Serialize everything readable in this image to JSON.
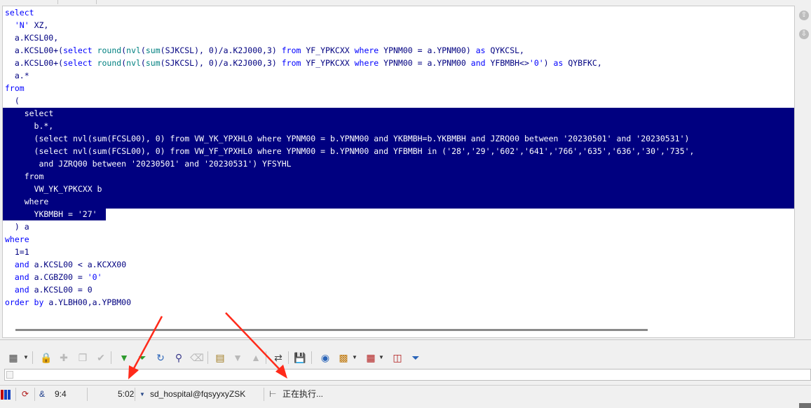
{
  "editor": {
    "lines": [
      {
        "spans": [
          [
            "k",
            "select"
          ]
        ]
      },
      {
        "spans": [
          [
            "t",
            "  "
          ],
          [
            "s",
            "'N'"
          ],
          [
            "t",
            " XZ,"
          ]
        ]
      },
      {
        "spans": [
          [
            "t",
            "  a.KCSL00,"
          ]
        ]
      },
      {
        "spans": [
          [
            "t",
            "  a.KCSL00+("
          ],
          [
            "k",
            "select"
          ],
          [
            "t",
            " "
          ],
          [
            "f",
            "round"
          ],
          [
            "t",
            "("
          ],
          [
            "f",
            "nvl"
          ],
          [
            "t",
            "("
          ],
          [
            "f",
            "sum"
          ],
          [
            "t",
            "(SJKCSL), 0)/a.K2J000,3) "
          ],
          [
            "k",
            "from"
          ],
          [
            "t",
            " YF_YPKCXX "
          ],
          [
            "k",
            "where"
          ],
          [
            "t",
            " YPNM00 = a.YPNM00) "
          ],
          [
            "k",
            "as"
          ],
          [
            "t",
            " QYKCSL,"
          ]
        ]
      },
      {
        "spans": [
          [
            "t",
            "  a.KCSL00+("
          ],
          [
            "k",
            "select"
          ],
          [
            "t",
            " "
          ],
          [
            "f",
            "round"
          ],
          [
            "t",
            "("
          ],
          [
            "f",
            "nvl"
          ],
          [
            "t",
            "("
          ],
          [
            "f",
            "sum"
          ],
          [
            "t",
            "(SJKCSL), 0)/a.K2J000,3) "
          ],
          [
            "k",
            "from"
          ],
          [
            "t",
            " YF_YPKCXX "
          ],
          [
            "k",
            "where"
          ],
          [
            "t",
            " YPNM00 = a.YPNM00 "
          ],
          [
            "k",
            "and"
          ],
          [
            "t",
            " YFBMBH<>"
          ],
          [
            "s",
            "'0'"
          ],
          [
            "t",
            ") "
          ],
          [
            "k",
            "as"
          ],
          [
            "t",
            " QYBFKC,"
          ]
        ]
      },
      {
        "spans": [
          [
            "t",
            "  a.*"
          ]
        ]
      },
      {
        "spans": [
          [
            "k",
            "from"
          ]
        ]
      },
      {
        "spans": [
          [
            "t",
            "  ("
          ]
        ]
      },
      {
        "spans": [
          [
            "t",
            "    "
          ],
          [
            "k",
            "select"
          ]
        ]
      },
      {
        "spans": [
          [
            "t",
            "      b.*,"
          ]
        ]
      },
      {
        "spans": [
          [
            "t",
            "      ("
          ],
          [
            "k",
            "select"
          ],
          [
            "t",
            " "
          ],
          [
            "f",
            "nvl"
          ],
          [
            "t",
            "("
          ],
          [
            "f",
            "sum"
          ],
          [
            "t",
            "(FCSL00), 0) "
          ],
          [
            "k",
            "from"
          ],
          [
            "t",
            " VW_YK_YPXHL0 "
          ],
          [
            "k",
            "where"
          ],
          [
            "t",
            " YPNM00 = b.YPNM00 "
          ],
          [
            "k",
            "and"
          ],
          [
            "t",
            " YKBMBH=b.YKBMBH "
          ],
          [
            "k",
            "and"
          ],
          [
            "t",
            " JZRQ00 "
          ],
          [
            "k",
            "between"
          ],
          [
            "t",
            " "
          ],
          [
            "s",
            "'20230501'"
          ],
          [
            "t",
            " "
          ],
          [
            "k",
            "and"
          ],
          [
            "t",
            " "
          ],
          [
            "s",
            "'20230531'"
          ],
          [
            "t",
            ")"
          ]
        ]
      },
      {
        "spans": [
          [
            "t",
            "      ("
          ],
          [
            "k",
            "select"
          ],
          [
            "t",
            " "
          ],
          [
            "f",
            "nvl"
          ],
          [
            "t",
            "("
          ],
          [
            "f",
            "sum"
          ],
          [
            "t",
            "(FCSL00), 0) "
          ],
          [
            "k",
            "from"
          ],
          [
            "t",
            " VW_YF_YPXHL0 "
          ],
          [
            "k",
            "where"
          ],
          [
            "t",
            " YPNM00 = b.YPNM00 "
          ],
          [
            "k",
            "and"
          ],
          [
            "t",
            " YFBMBH "
          ],
          [
            "k",
            "in"
          ],
          [
            "t",
            " ("
          ],
          [
            "s",
            "'28'"
          ],
          [
            "t",
            ","
          ],
          [
            "s",
            "'29'"
          ],
          [
            "t",
            ","
          ],
          [
            "s",
            "'602'"
          ],
          [
            "t",
            ","
          ],
          [
            "s",
            "'641'"
          ],
          [
            "t",
            ","
          ],
          [
            "s",
            "'766'"
          ],
          [
            "t",
            ","
          ],
          [
            "s",
            "'635'"
          ],
          [
            "t",
            ","
          ],
          [
            "s",
            "'636'"
          ],
          [
            "t",
            ","
          ],
          [
            "s",
            "'30'"
          ],
          [
            "t",
            ","
          ],
          [
            "s",
            "'735'"
          ],
          [
            "t",
            ","
          ]
        ]
      },
      {
        "spans": [
          [
            "t",
            "       "
          ],
          [
            "k",
            "and"
          ],
          [
            "t",
            " JZRQ00 "
          ],
          [
            "k",
            "between"
          ],
          [
            "t",
            " "
          ],
          [
            "s",
            "'20230501'"
          ],
          [
            "t",
            " "
          ],
          [
            "k",
            "and"
          ],
          [
            "t",
            " "
          ],
          [
            "s",
            "'20230531'"
          ],
          [
            "t",
            ") YFSYHL"
          ]
        ]
      },
      {
        "spans": [
          [
            "t",
            "    "
          ],
          [
            "k",
            "from"
          ]
        ]
      },
      {
        "spans": [
          [
            "t",
            "      VW_YK_YPKCXX b"
          ]
        ]
      },
      {
        "spans": [
          [
            "t",
            "    "
          ],
          [
            "k",
            "where"
          ]
        ]
      },
      {
        "spans": [
          [
            "t",
            "      YKBMBH = "
          ],
          [
            "s",
            "'27'"
          ]
        ]
      },
      {
        "spans": [
          [
            "t",
            "  ) a"
          ]
        ]
      },
      {
        "spans": [
          [
            "k",
            "where"
          ]
        ]
      },
      {
        "spans": [
          [
            "t",
            "  1=1"
          ]
        ]
      },
      {
        "spans": [
          [
            "t",
            "  "
          ],
          [
            "k",
            "and"
          ],
          [
            "t",
            " a.KCSL00 < a.KCXX00"
          ]
        ]
      },
      {
        "spans": [
          [
            "t",
            "  "
          ],
          [
            "k",
            "and"
          ],
          [
            "t",
            " a.CGBZ00 = "
          ],
          [
            "s",
            "'0'"
          ]
        ]
      },
      {
        "spans": [
          [
            "t",
            "  "
          ],
          [
            "k",
            "and"
          ],
          [
            "t",
            " a.KCSL00 = 0"
          ]
        ]
      },
      {
        "spans": [
          [
            "k",
            "order by"
          ],
          [
            "t",
            " a.YLBH00,a.YPBM00"
          ]
        ]
      }
    ],
    "selected_lines": [
      8,
      16
    ]
  },
  "toolbar": {
    "icons": [
      "dbms-output-icon",
      "lock-icon",
      "new-icon",
      "copy-icon",
      "commit-icon",
      "fetch-next-icon",
      "fetch-all-icon",
      "refresh-icon",
      "find-icon",
      "clear-icon",
      "query-by-example-icon",
      "sort-desc-icon",
      "sort-asc-icon",
      "export-icon",
      "save-icon",
      "explain-plan-icon",
      "chart-icon",
      "grid-icon",
      "compare-icon",
      "filter-icon"
    ]
  },
  "status": {
    "cursor": "9:4",
    "elapsed": "5:02",
    "connection": "sd_hospital@fqsyyxyZSK",
    "message": "正在执行...",
    "symbol": "&"
  },
  "colors": {
    "selection": "#000080",
    "keyword": "#0000ff",
    "function": "#008080",
    "identifier": "#000080",
    "annotation_arrow": "#ff2a1a"
  }
}
